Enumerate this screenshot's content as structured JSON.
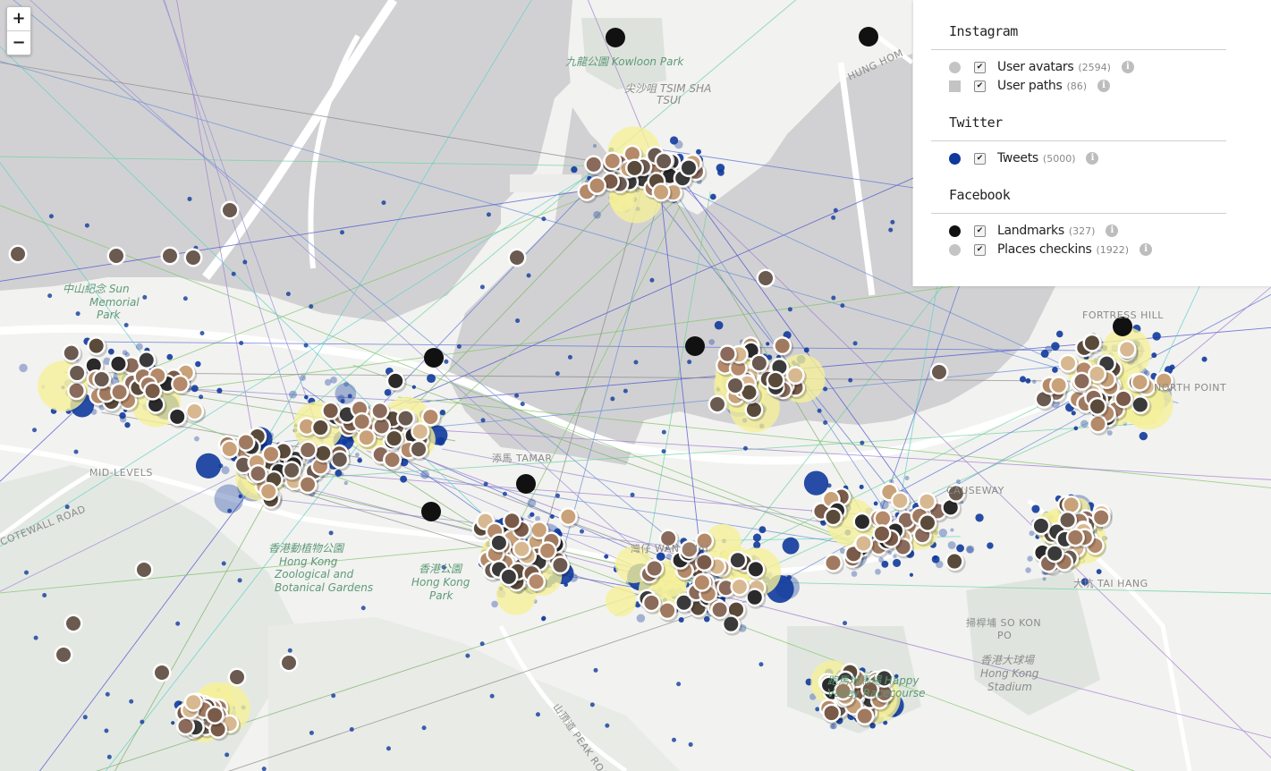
{
  "zoom": {
    "in_label": "+",
    "out_label": "−"
  },
  "legend": {
    "groups": [
      {
        "title": "Instagram",
        "items": [
          {
            "label": "User avatars",
            "count": "(2594)",
            "color": "#c4c4c4",
            "shape": "round",
            "checked": true
          },
          {
            "label": "User paths",
            "count": "(86)",
            "color": "#c4c4c4",
            "shape": "square",
            "checked": true
          }
        ]
      },
      {
        "title": "Twitter",
        "items": [
          {
            "label": "Tweets",
            "count": "(5000)",
            "color": "#0f3a9c",
            "shape": "round",
            "checked": true
          }
        ]
      },
      {
        "title": "Facebook",
        "items": [
          {
            "label": "Landmarks",
            "count": "(327)",
            "color": "#111111",
            "shape": "round",
            "checked": true
          },
          {
            "label": "Places checkins",
            "count": "(1922)",
            "color": "#c4c4c4",
            "shape": "round",
            "checked": true
          }
        ]
      }
    ],
    "check_glyph": "✔",
    "info_glyph": "i"
  },
  "map_labels": {
    "kowloon_park": "九龍公園 Kowloon Park",
    "tsim_sha_tsui_1": "尖沙咀 TSIM SHA",
    "tsim_sha_tsui_2": "TSUI",
    "hung_hom": "HUNG HOM",
    "sun_memorial_1": "中山紀念 Sun",
    "sun_memorial_2": "Memorial",
    "sun_memorial_3": "Park",
    "mid_levels": "MID-LEVELS",
    "tamar": "添馬 TAMAR",
    "wan_chai": "灣仔 WAN CHAI",
    "causeway": "CAUSEWAY",
    "fortress_hill": "FORTRESS HILL",
    "north_point": "NORTH POINT",
    "tai_hang": "大坑 TAI HANG",
    "so_kon_po_1": "掃桿埔 SO KON",
    "so_kon_po_2": "PO",
    "stadium_1": "香港大球場",
    "stadium_2": "Hong Kong",
    "stadium_3": "Stadium",
    "happy_valley_1": "跑馬地馬場 Happy",
    "happy_valley_2": "Valley Racecourse",
    "zoo_1": "香港動植物公園",
    "zoo_2": "Hong Kong",
    "zoo_3": "Zoological and",
    "zoo_4": "Botanical Gardens",
    "hk_park_1": "香港公園",
    "hk_park_2": "Hong Kong",
    "hk_park_3": "Park",
    "peak_road": "山頂道 PEAK ROAD",
    "cotewall_road": "COTEWALL ROAD"
  },
  "colors": {
    "water": "#d1d1d3",
    "land": "#f2f2f0",
    "park": "#e0e6e0",
    "tweet": "#0f3a9c",
    "checkin_highlight": "#f7f3a0",
    "avatar_ring": "#ffffff"
  }
}
